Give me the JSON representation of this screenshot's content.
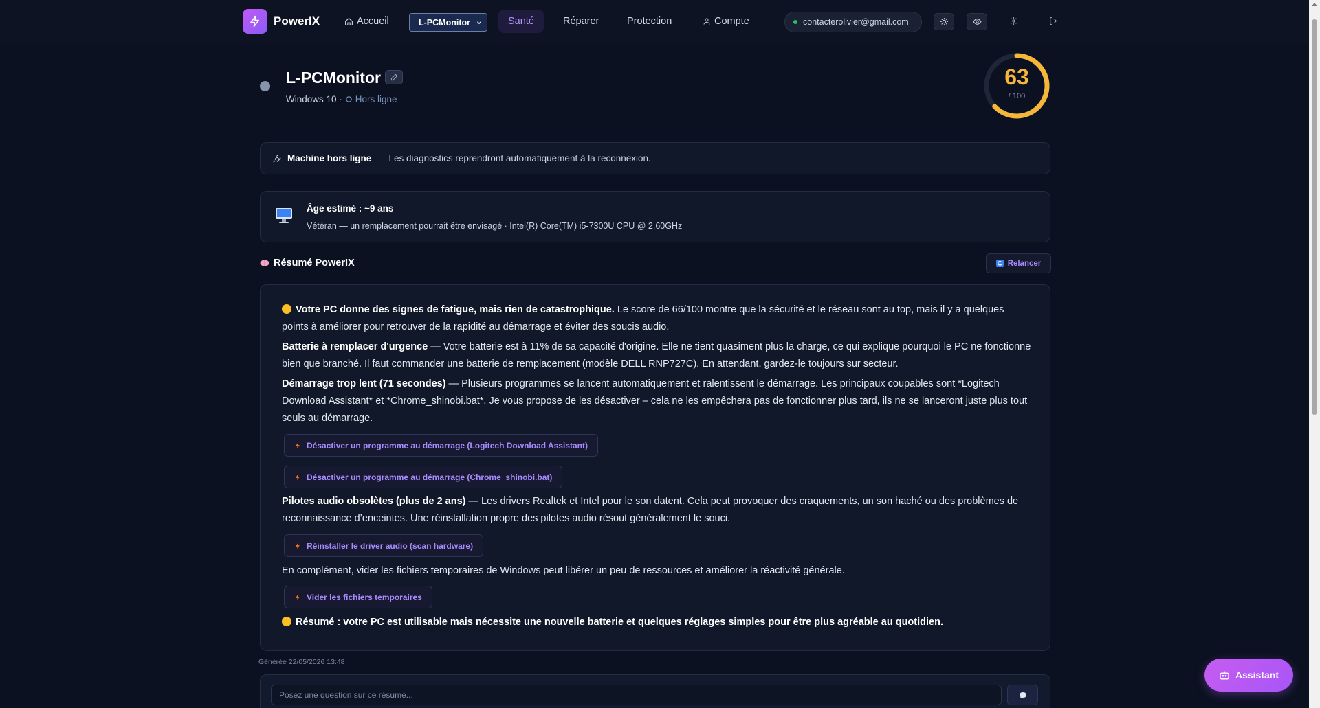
{
  "nav": {
    "brand": "PowerIX",
    "home": "Accueil",
    "device_select": "L-PCMonitor",
    "health": "Santé",
    "repair": "Réparer",
    "protection": "Protection",
    "account": "Compte",
    "email": "contacterolivier@gmail.com"
  },
  "device": {
    "name": "L-PCMonitor",
    "os": "Windows 10 ·",
    "status": "Hors ligne",
    "score": "63",
    "score_max": "/ 100",
    "score_value": 63
  },
  "offline_notice": {
    "title": "Machine hors ligne",
    "text": "— Les diagnostics reprendront automatiquement à la reconnexion."
  },
  "age": {
    "title": "Âge estimé : ~9 ans",
    "subtitle": "Vétéran — un remplacement pourrait être envisagé · Intel(R) Core(TM) i5-7300U CPU @ 2.60GHz"
  },
  "summary": {
    "title": "Résumé PowerIX",
    "relaunch": "Relancer",
    "p1_bold": "Votre PC donne des signes de fatigue, mais rien de catastrophique.",
    "p1_text": " Le score de 66/100 montre que la sécurité et le réseau sont au top, mais il y a quelques points à améliorer pour retrouver de la rapidité au démarrage et éviter des soucis audio.",
    "p2_bold": "Batterie à remplacer d'urgence",
    "p2_text": " — Votre batterie est à 11% de sa capacité d'origine. Elle ne tient quasiment plus la charge, ce qui explique pourquoi le PC ne fonctionne bien que branché. Il faut commander une batterie de remplacement (modèle DELL RNP727C). En attendant, gardez-le toujours sur secteur.",
    "p3_bold": "Démarrage trop lent (71 secondes)",
    "p3_text": " — Plusieurs programmes se lancent automatiquement et ralentissent le démarrage. Les principaux coupables sont *Logitech Download Assistant* et *Chrome_shinobi.bat*. Je vous propose de les désactiver – cela ne les empêchera pas de fonctionner plus tard, ils ne se lanceront juste plus tout seuls au démarrage.",
    "action1": "Désactiver un programme au démarrage (Logitech Download Assistant)",
    "action2": "Désactiver un programme au démarrage (Chrome_shinobi.bat)",
    "p4_bold": "Pilotes audio obsolètes (plus de 2 ans)",
    "p4_text": " — Les drivers Realtek et Intel pour le son datent. Cela peut provoquer des craquements, un son haché ou des problèmes de reconnaissance d’enceintes. Une réinstallation propre des pilotes audio résout généralement le souci.",
    "action3": "Réinstaller le driver audio (scan hardware)",
    "p5_text": "En complément, vider les fichiers temporaires de Windows peut libérer un peu de ressources et améliorer la réactivité générale.",
    "action4": "Vider les fichiers temporaires",
    "p6_bold": "Résumé : votre PC est utilisable mais nécessite une nouvelle batterie et quelques réglages simples pour être plus agréable au quotidien.",
    "generated": "Générée 22/05/2026 13:48"
  },
  "ask": {
    "placeholder": "Posez une question sur ce résumé..."
  },
  "assistant": "Assistant",
  "colors": {
    "accent": "#a88bff",
    "score": "#f5b63a",
    "background": "#0b1120"
  }
}
